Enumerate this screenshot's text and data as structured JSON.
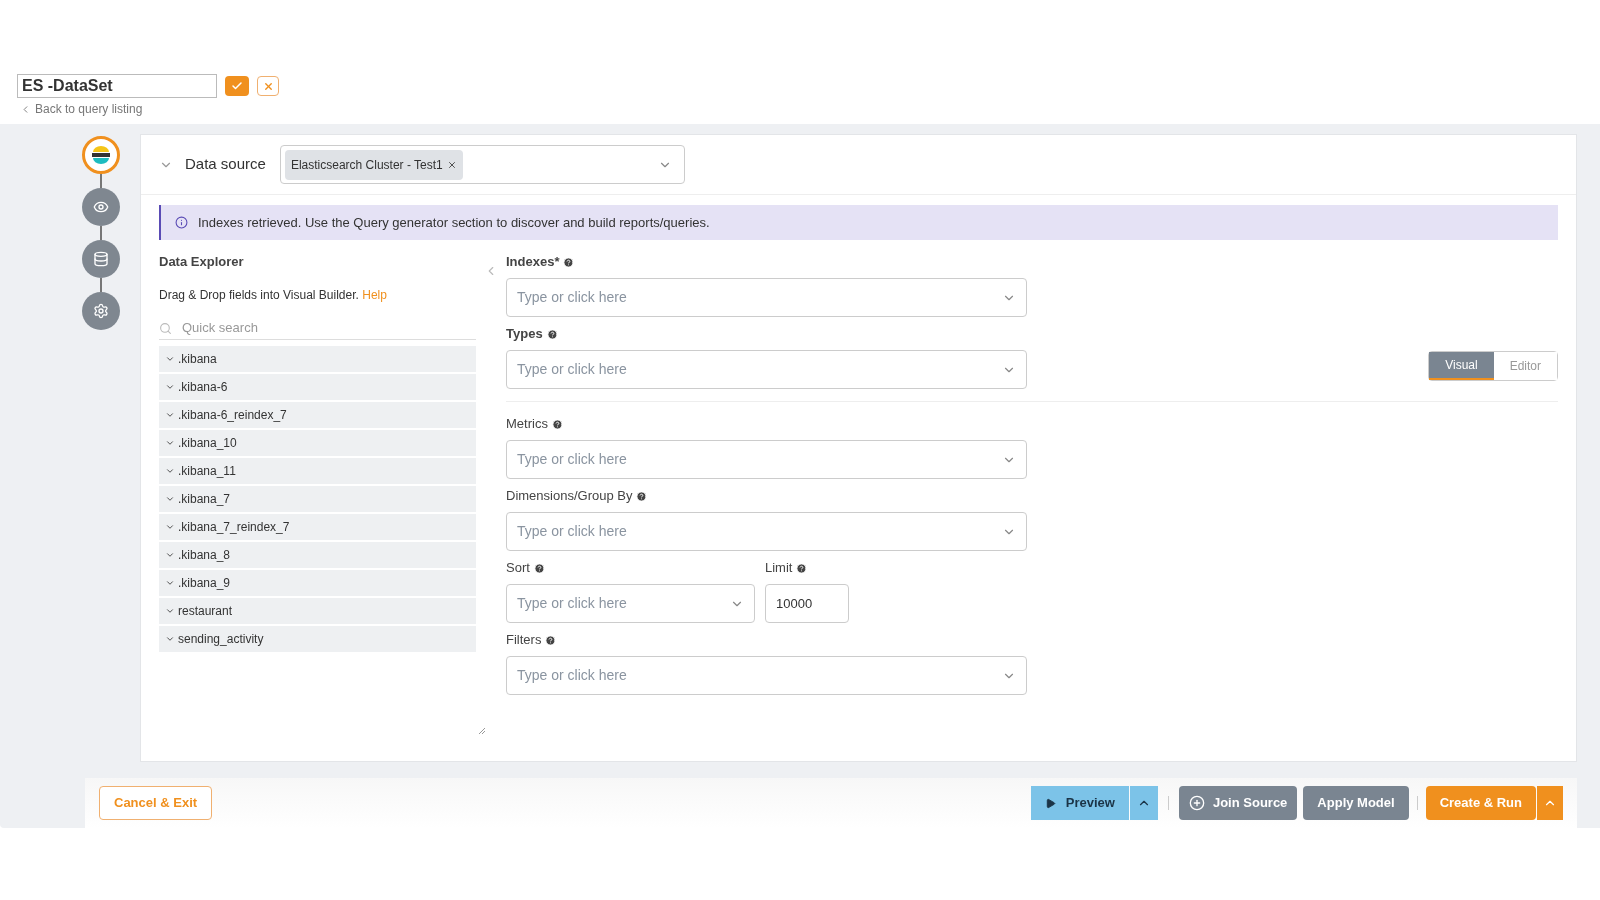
{
  "header": {
    "title": "ES -DataSet",
    "back_link": "Back to query listing"
  },
  "steps": [
    {
      "kind": "source",
      "selected": true
    },
    {
      "kind": "preview",
      "selected": false
    },
    {
      "kind": "data",
      "selected": false
    },
    {
      "kind": "settings",
      "selected": false
    }
  ],
  "data_source": {
    "label": "Data source",
    "expanded": true,
    "tags": [
      "Elasticsearch Cluster - Test1"
    ]
  },
  "info_banner": "Indexes retrieved. Use the Query generator section to discover and build reports/queries.",
  "explorer": {
    "title": "Data Explorer",
    "hint": "Drag & Drop fields into Visual Builder.",
    "help_link": "Help",
    "search_placeholder": "Quick search",
    "items": [
      {
        "label": ".kibana",
        "expanded": false
      },
      {
        "label": ".kibana-6",
        "expanded": false
      },
      {
        "label": ".kibana-6_reindex_7",
        "expanded": false
      },
      {
        "label": ".kibana_10",
        "expanded": false
      },
      {
        "label": ".kibana_11",
        "expanded": false
      },
      {
        "label": ".kibana_7",
        "expanded": false
      },
      {
        "label": ".kibana_7_reindex_7",
        "expanded": false
      },
      {
        "label": ".kibana_8",
        "expanded": false
      },
      {
        "label": ".kibana_9",
        "expanded": false
      },
      {
        "label": "restaurant",
        "expanded": false
      },
      {
        "label": "sending_activity",
        "expanded": false
      }
    ]
  },
  "mode_toggle": [
    {
      "label": "Visual",
      "selected": true
    },
    {
      "label": "Editor",
      "selected": false
    }
  ],
  "form": [
    {
      "fields": [
        {
          "kind": "select",
          "label": "Indexes*",
          "placeholder": "Type or click here"
        }
      ],
      "divider_after": false
    },
    {
      "fields": [
        {
          "kind": "select",
          "label": "Types",
          "placeholder": "Type or click here"
        }
      ],
      "divider_after": true
    },
    {
      "fields": [
        {
          "kind": "select",
          "label": "Metrics",
          "placeholder": "Type or click here"
        }
      ],
      "divider_after": false
    },
    {
      "fields": [
        {
          "kind": "select",
          "label": "Dimensions/Group By",
          "placeholder": "Type or click here"
        }
      ],
      "divider_after": false
    },
    {
      "fields": [
        {
          "kind": "select",
          "label": "Sort",
          "placeholder": "Type or click here"
        },
        {
          "kind": "input",
          "label": "Limit",
          "value": "10000"
        }
      ],
      "divider_after": false
    },
    {
      "fields": [
        {
          "kind": "select",
          "label": "Filters",
          "placeholder": "Type or click here"
        }
      ],
      "divider_after": false
    }
  ],
  "footer": {
    "cancel": "Cancel & Exit",
    "preview": "Preview",
    "join_source": "Join Source",
    "apply_model": "Apply Model",
    "create_run": "Create & Run"
  }
}
